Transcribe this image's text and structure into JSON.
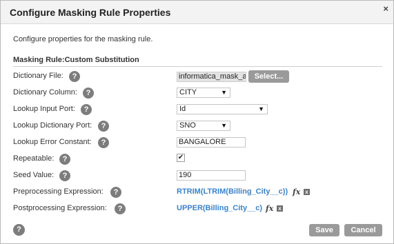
{
  "dialog": {
    "title": "Configure Masking Rule Properties",
    "close_glyph": "×",
    "intro": "Configure properties for the masking rule.",
    "section_title": "Masking Rule:Custom Substitution"
  },
  "fields": {
    "dictionary_file": {
      "label": "Dictionary File:",
      "value": "informatica_mask_ac",
      "button": "Select..."
    },
    "dictionary_column": {
      "label": "Dictionary Column:",
      "value": "CITY"
    },
    "lookup_input_port": {
      "label": "Lookup Input Port:",
      "value": "Id"
    },
    "lookup_dictionary_port": {
      "label": "Lookup Dictionary Port:",
      "value": "SNO"
    },
    "lookup_error_constant": {
      "label": "Lookup Error Constant:",
      "value": "BANGALORE"
    },
    "repeatable": {
      "label": "Repeatable:",
      "checked": true,
      "check_glyph": "✔"
    },
    "seed_value": {
      "label": "Seed Value:",
      "value": "190"
    },
    "preprocessing_expression": {
      "label": "Preprocessing Expression:",
      "value": "RTRIM(LTRIM(Billing_City__c))"
    },
    "postprocessing_expression": {
      "label": "Postprocessing Expression:",
      "value": "UPPER(Billing_City__c)"
    }
  },
  "icons": {
    "help": "?",
    "dropdown_arrow": "▼",
    "fx": "fx",
    "clear": "x"
  },
  "footer": {
    "save": "Save",
    "cancel": "Cancel"
  },
  "colors": {
    "expression_link": "#3a82c9",
    "button_gray": "#9a9a9a",
    "help_icon": "#7d7d7d"
  }
}
